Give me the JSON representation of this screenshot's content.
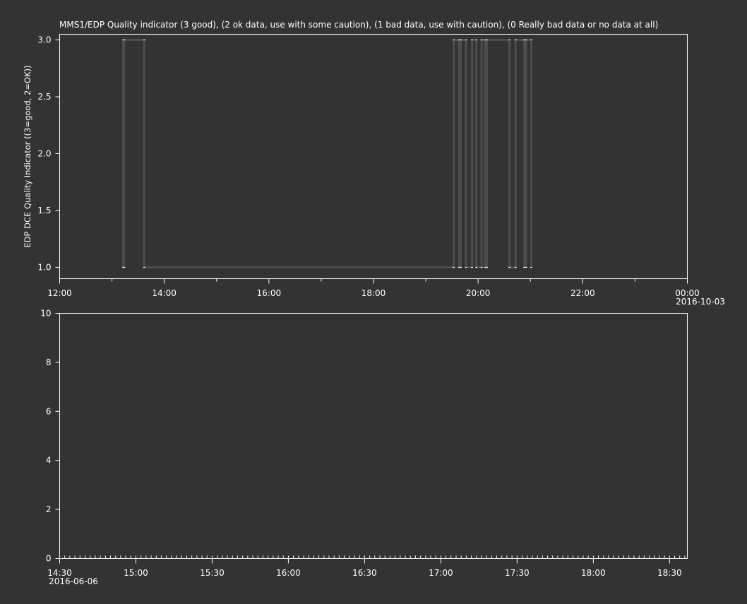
{
  "theme": {
    "background": "#333333",
    "foreground": "#ffffff",
    "trace": "#4d4d4d"
  },
  "chart_data": [
    {
      "type": "line",
      "title": "MMS1/EDP  Quality indicator (3 good), (2 ok data, use with some caution), (1 bad data, use with caution), (0 Really bad data or no data at all)",
      "ylabel": "EDP DCE Quality Indicator ((3=good, 2=OK))",
      "xlabel": "",
      "x_range": [
        "2016-10-02T12:00",
        "2016-10-03T00:00"
      ],
      "ylim": [
        0.9,
        3.05
      ],
      "x_ticks": [
        {
          "t": "2016-10-02T12:00",
          "label": "12:00"
        },
        {
          "t": "2016-10-02T14:00",
          "label": "14:00"
        },
        {
          "t": "2016-10-02T16:00",
          "label": "16:00"
        },
        {
          "t": "2016-10-02T18:00",
          "label": "18:00"
        },
        {
          "t": "2016-10-02T20:00",
          "label": "20:00"
        },
        {
          "t": "2016-10-02T22:00",
          "label": "22:00"
        },
        {
          "t": "2016-10-03T00:00",
          "label": "00:00"
        }
      ],
      "x_minor_ticks": [
        "2016-10-02T13:00",
        "2016-10-02T15:00",
        "2016-10-02T17:00",
        "2016-10-02T19:00",
        "2016-10-02T21:00",
        "2016-10-02T23:00"
      ],
      "date_label": "2016-10-03",
      "y_ticks": [
        1.0,
        1.5,
        2.0,
        2.5,
        3.0
      ],
      "y_tick_labels": [
        "1.0",
        "1.5",
        "2.0",
        "2.5",
        "3.0"
      ],
      "grid": false,
      "series": [
        {
          "x": [
            "2016-10-02T13:13",
            "2016-10-02T13:13",
            "2016-10-02T13:14",
            "2016-10-02T13:14",
            "2016-10-02T13:37",
            "2016-10-02T13:37",
            "2016-10-02T19:32",
            "2016-10-02T19:32",
            "2016-10-02T19:38",
            "2016-10-02T19:38",
            "2016-10-02T19:40",
            "2016-10-02T19:40",
            "2016-10-02T19:46",
            "2016-10-02T19:46",
            "2016-10-02T19:53",
            "2016-10-02T19:53",
            "2016-10-02T19:58",
            "2016-10-02T19:58",
            "2016-10-02T20:04",
            "2016-10-02T20:04",
            "2016-10-02T20:08",
            "2016-10-02T20:08",
            "2016-10-02T20:10",
            "2016-10-02T20:10",
            "2016-10-02T20:36",
            "2016-10-02T20:36",
            "2016-10-02T20:43",
            "2016-10-02T20:43",
            "2016-10-02T20:53",
            "2016-10-02T20:53",
            "2016-10-02T20:55",
            "2016-10-02T20:55",
            "2016-10-02T21:01",
            "2016-10-02T21:01"
          ],
          "y": [
            3,
            1,
            1,
            3,
            3,
            1,
            1,
            3,
            3,
            1,
            1,
            3,
            3,
            1,
            1,
            3,
            3,
            1,
            1,
            3,
            3,
            1,
            1,
            3,
            3,
            1,
            1,
            3,
            3,
            1,
            1,
            3,
            3,
            1
          ]
        }
      ]
    },
    {
      "type": "line",
      "title": "",
      "ylabel": "",
      "xlabel": "",
      "x_range": [
        "2016-06-06T14:30",
        "2016-06-06T18:37"
      ],
      "ylim": [
        0,
        10
      ],
      "x_ticks": [
        {
          "t": "2016-06-06T14:30",
          "label": "14:30"
        },
        {
          "t": "2016-06-06T15:00",
          "label": "15:00"
        },
        {
          "t": "2016-06-06T15:30",
          "label": "15:30"
        },
        {
          "t": "2016-06-06T16:00",
          "label": "16:00"
        },
        {
          "t": "2016-06-06T16:30",
          "label": "16:30"
        },
        {
          "t": "2016-06-06T17:00",
          "label": "17:00"
        },
        {
          "t": "2016-06-06T17:30",
          "label": "17:30"
        },
        {
          "t": "2016-06-06T18:00",
          "label": "18:00"
        },
        {
          "t": "2016-06-06T18:30",
          "label": "18:30"
        }
      ],
      "x_minor_tick_every_minutes": 2,
      "date_label": "2016-06-06",
      "y_ticks": [
        0,
        2,
        4,
        6,
        8,
        10
      ],
      "y_tick_labels": [
        "0",
        "2",
        "4",
        "6",
        "8",
        "10"
      ],
      "grid": false,
      "series": []
    }
  ]
}
